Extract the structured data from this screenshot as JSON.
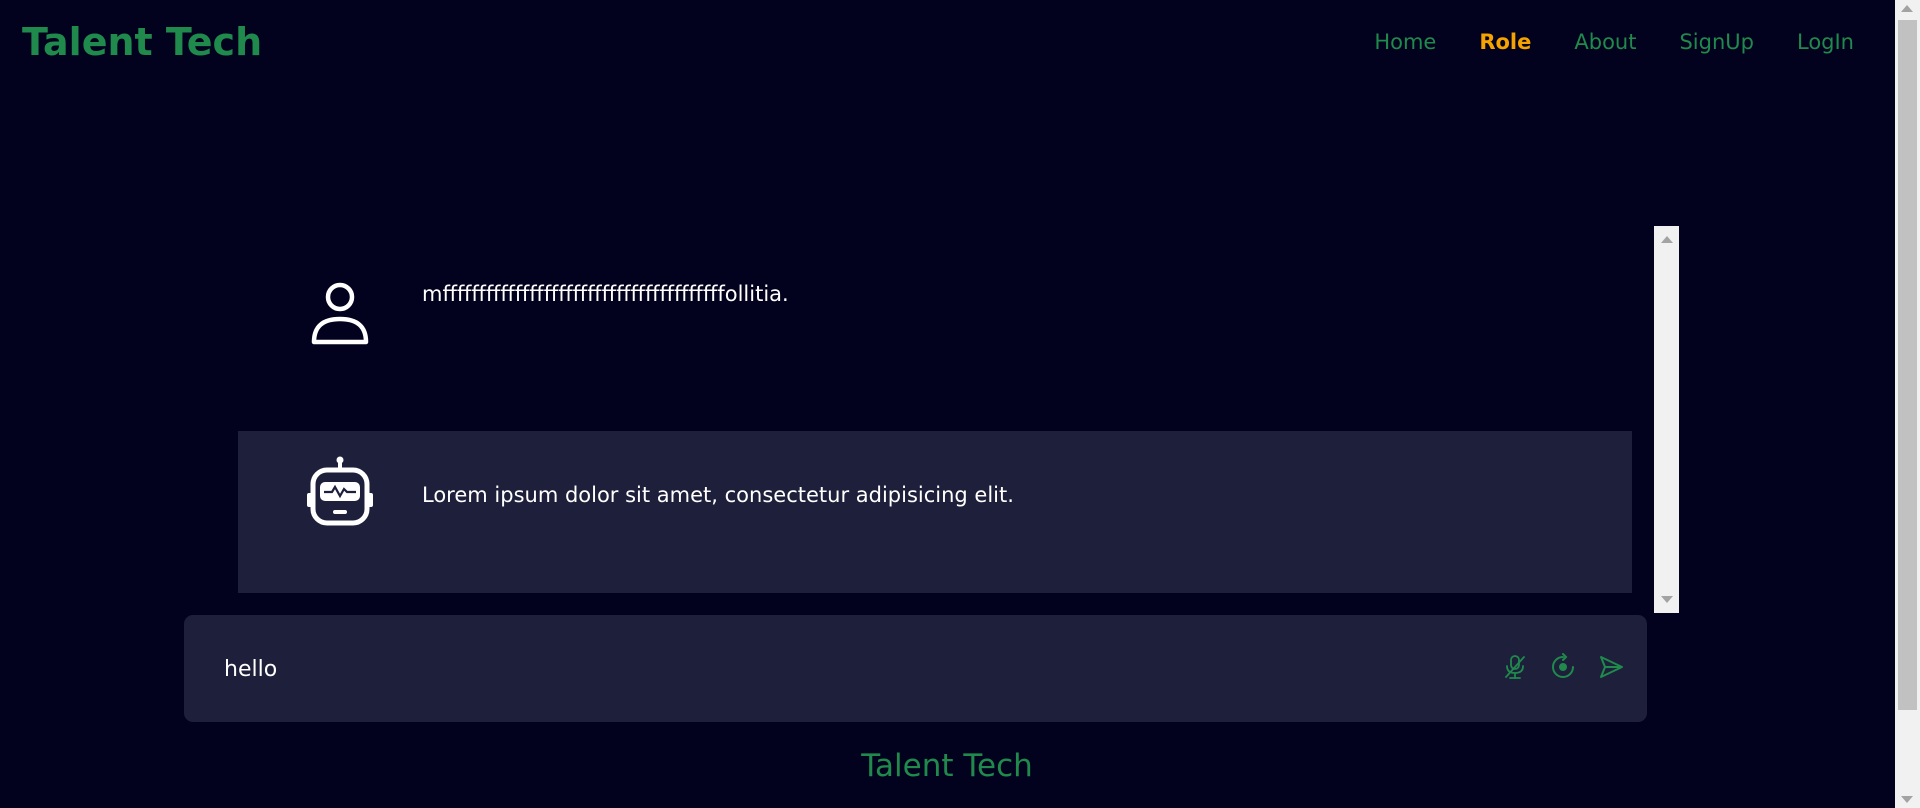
{
  "header": {
    "brand": "Talent Tech",
    "nav": [
      {
        "label": "Home"
      },
      {
        "label": "Role",
        "active": true
      },
      {
        "label": "About"
      },
      {
        "label": "SignUp"
      },
      {
        "label": "LogIn"
      }
    ]
  },
  "chat": {
    "messages": [
      {
        "role": "user",
        "avatar_icon": "user-icon",
        "text": "mfffffffffffffffffffffffffffffffffffffffollitia."
      },
      {
        "role": "bot",
        "avatar_icon": "robot-icon",
        "text": "Lorem ipsum dolor sit amet, consectetur adipisicing elit."
      }
    ]
  },
  "input": {
    "value": "hello",
    "icons": [
      "mic-off-icon",
      "record-icon",
      "send-icon"
    ]
  },
  "footer": {
    "brand": "Talent Tech"
  },
  "colors": {
    "background": "#02021e",
    "panel": "#1e1f3b",
    "brand_green": "#1f8a4c",
    "active_nav": "#f5a300",
    "text": "#ffffff"
  }
}
